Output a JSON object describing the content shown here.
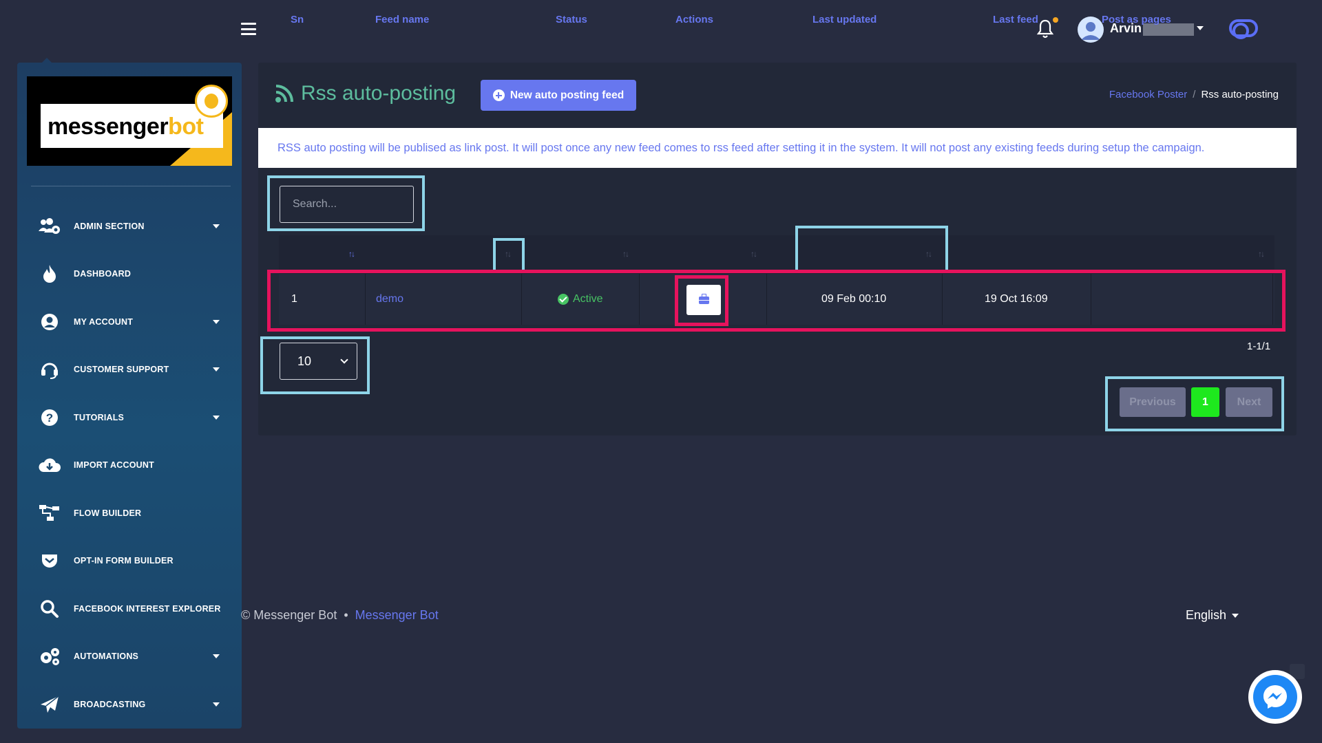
{
  "header": {
    "menu_icon": "hamburger-icon",
    "notification_icon": "bell-icon",
    "user_name": "Arvin",
    "theme_toggle_icon": "toggle-icon"
  },
  "sidebar": {
    "logo_text_main": "messenger",
    "logo_text_accent": "bot",
    "items": [
      {
        "label": "ADMIN SECTION",
        "icon": "users-cog-icon",
        "has_submenu": true
      },
      {
        "label": "DASHBOARD",
        "icon": "fire-icon",
        "has_submenu": false
      },
      {
        "label": "MY ACCOUNT",
        "icon": "user-circle-icon",
        "has_submenu": true
      },
      {
        "label": "CUSTOMER SUPPORT",
        "icon": "headset-icon",
        "has_submenu": true
      },
      {
        "label": "TUTORIALS",
        "icon": "question-circle-icon",
        "has_submenu": true
      },
      {
        "label": "IMPORT ACCOUNT",
        "icon": "cloud-download-icon",
        "has_submenu": false
      },
      {
        "label": "FLOW BUILDER",
        "icon": "sitemap-icon",
        "has_submenu": false
      },
      {
        "label": "OPT-IN FORM BUILDER",
        "icon": "pocket-icon",
        "has_submenu": false
      },
      {
        "label": "FACEBOOK INTEREST EXPLORER",
        "icon": "search-icon",
        "has_submenu": false
      },
      {
        "label": "AUTOMATIONS",
        "icon": "cogs-icon",
        "has_submenu": true
      },
      {
        "label": "BROADCASTING",
        "icon": "paper-plane-icon",
        "has_submenu": true
      }
    ]
  },
  "page": {
    "title": "Rss auto-posting",
    "title_icon": "rss-icon",
    "new_button_label": "New auto posting feed",
    "breadcrumb": {
      "parent": "Facebook Poster",
      "current": "Rss auto-posting"
    },
    "notice": "RSS auto posting will be publised as link post. It will post once any new feed comes to rss feed after setting it in the system. It will not post any existing feeds during setup the campaign."
  },
  "table": {
    "search_placeholder": "Search...",
    "columns": [
      "Sn",
      "Feed name",
      "Status",
      "Actions",
      "Last updated",
      "Last feed",
      "Post as pages"
    ],
    "rows": [
      {
        "sn": "1",
        "feed_name": "demo",
        "status": "Active",
        "actions_icon": "briefcase-icon",
        "last_updated": "09 Feb 00:10",
        "last_feed": "19 Oct 16:09",
        "post_as_pages": ""
      }
    ],
    "page_size": "10",
    "range": "1-1/1",
    "pagination": {
      "previous": "Previous",
      "current": "1",
      "next": "Next"
    }
  },
  "footer": {
    "copyright": "© Messenger Bot",
    "separator": "•",
    "link": "Messenger Bot",
    "language": "English"
  },
  "colors": {
    "accent": "#6777ef",
    "title_green": "#5dbd9e",
    "active_green": "#47c363",
    "highlight_blue": "#8ed4e8",
    "highlight_pink": "#e6135d",
    "page_current": "#1ee81e"
  }
}
